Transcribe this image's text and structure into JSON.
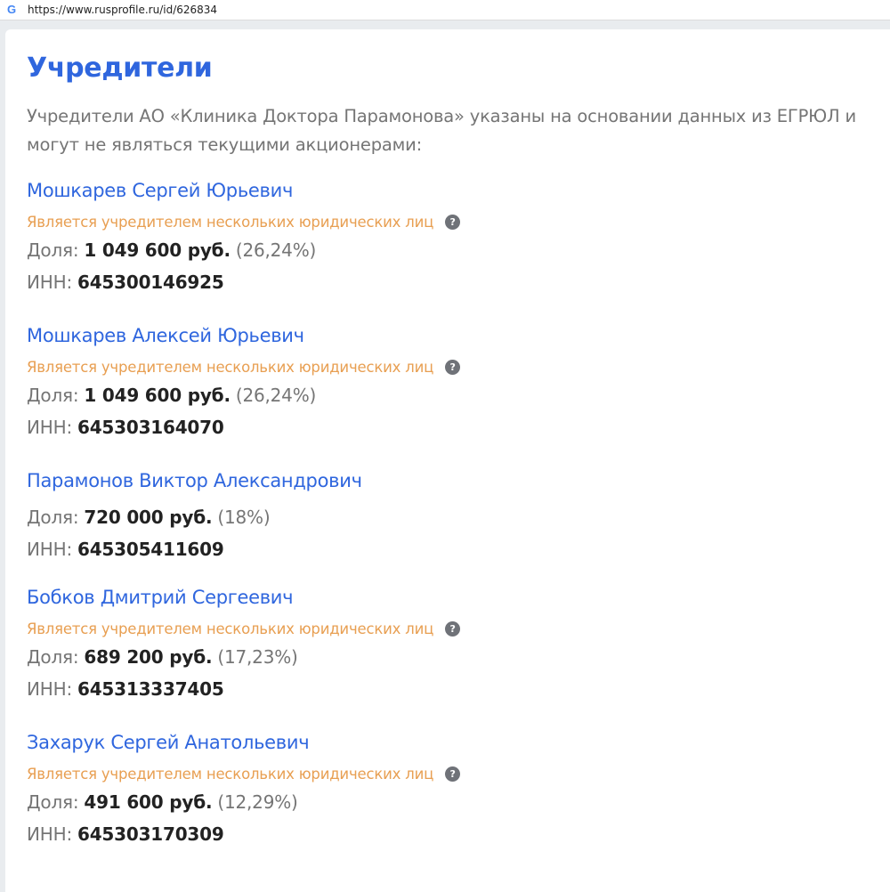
{
  "browser": {
    "url": "https://www.rusprofile.ru/id/626834",
    "favicon_letter": "G"
  },
  "section": {
    "title": "Учредители",
    "intro": "Учредители АО «Клиника Доктора Парамонова» указаны на основании данных из ЕГРЮЛ и могут не являться текущими акционерами:"
  },
  "labels": {
    "share": "Доля:",
    "inn": "ИНН:",
    "multi_note": "Является учредителем нескольких юридических лиц",
    "help": "?"
  },
  "founders": [
    {
      "name": "Мошкарев Сергей Юрьевич",
      "multi": true,
      "share_amount": "1 049 600 руб.",
      "share_percent": "(26,24%)",
      "inn": "645300146925"
    },
    {
      "name": "Мошкарев Алексей Юрьевич",
      "multi": true,
      "share_amount": "1 049 600 руб.",
      "share_percent": "(26,24%)",
      "inn": "645303164070"
    },
    {
      "name": "Парамонов Виктор Александрович",
      "multi": false,
      "share_amount": "720 000 руб.",
      "share_percent": "(18%)",
      "inn": "645305411609"
    },
    {
      "name": "Бобков Дмитрий Сергеевич",
      "multi": true,
      "share_amount": "689 200 руб.",
      "share_percent": "(17,23%)",
      "inn": "645313337405"
    },
    {
      "name": "Захарук Сергей Анатольевич",
      "multi": true,
      "share_amount": "491 600 руб.",
      "share_percent": "(12,29%)",
      "inn": "645303170309"
    }
  ],
  "colors": {
    "link": "#2f66de",
    "note": "#e89f52",
    "muted": "#757575",
    "strong": "#222222"
  }
}
